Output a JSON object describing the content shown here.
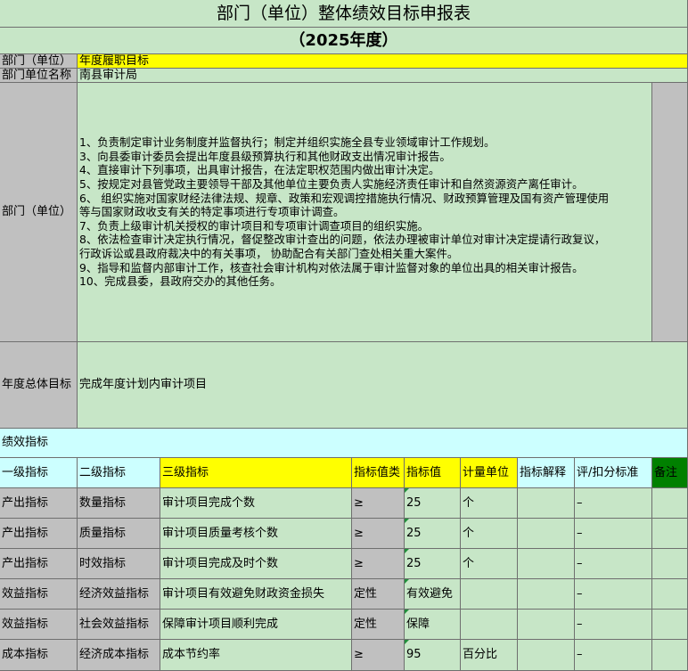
{
  "title": "部门（单位）整体绩效目标申报表",
  "year": "（2025年度）",
  "dept_label": "部门（单位）",
  "dept_value": "年度履职目标",
  "unit_name_label": "部门单位名称",
  "unit_name_value": "南县审计局",
  "duties_label": "部门（单位）",
  "duties": [
    "1、负责制定审计业务制度并监督执行；制定并组织实施全县专业领域审计工作规划。",
    "3、向县委审计委员会提出年度县级预算执行和其他财政支出情况审计报告。",
    "4、直接审计下列事项，出具审计报告，在法定职权范围内做出审计决定。",
    "5、按规定对县管党政主要领导干部及其他单位主要负责人实施经济责任审计和自然资源资产离任审计。",
    "6、  组织实施对国家财经法律法规、规章、政策和宏观调控措施执行情况、财政预算管理及国有资产管理使用",
    "等与国家财政收支有关的特定事项进行专项审计调查。",
    "7、负责上级审计机关授权的审计项目和专项审计调查项目的组织实施。",
    "8、依法检查审计决定执行情况，督促整改审计查出的问题，依法办理被审计单位对审计决定提请行政复议，",
    "行政诉讼或县政府裁决中的有关事项，  协助配合有关部门查处相关重大案件。",
    "9、指导和监督内部审计工作，核查社会审计机构对依法属于审计监督对象的单位出具的相关审计报告。",
    "10、完成县委，县政府交办的其他任务。"
  ],
  "annual_goal_label": "年度总体目标",
  "annual_goal_value": "完成年度计划内审计项目",
  "perf_section_label": "绩效指标",
  "headers": {
    "level1": "一级指标",
    "level2": "二级指标",
    "level3": "三级指标",
    "type": "指标值类",
    "value": "指标值",
    "unit": "计量单位",
    "explain": "指标解释",
    "score": "评/扣分标准",
    "note": "备注"
  },
  "rows": [
    {
      "level1": "产出指标",
      "level2": "数量指标",
      "level3": "审计项目完成个数",
      "type": "≥",
      "value": "25",
      "unit": "个",
      "explain": "",
      "score": "–",
      "note": ""
    },
    {
      "level1": "产出指标",
      "level2": "质量指标",
      "level3": "审计项目质量考核个数",
      "type": "≥",
      "value": "25",
      "unit": "个",
      "explain": "",
      "score": "–",
      "note": ""
    },
    {
      "level1": "产出指标",
      "level2": "时效指标",
      "level3": "审计项目完成及时个数",
      "type": "≥",
      "value": "25",
      "unit": "个",
      "explain": "",
      "score": "–",
      "note": ""
    },
    {
      "level1": "效益指标",
      "level2": "经济效益指标",
      "level3": "审计项目有效避免财政资金损失",
      "type": "定性",
      "value": "有效避免",
      "unit": "",
      "explain": "",
      "score": "–",
      "note": ""
    },
    {
      "level1": "效益指标",
      "level2": "社会效益指标",
      "level3": "保障审计项目顺利完成",
      "type": "定性",
      "value": "保障",
      "unit": "",
      "explain": "",
      "score": "–",
      "note": ""
    },
    {
      "level1": "成本指标",
      "level2": "经济成本指标",
      "level3": "成本节约率",
      "type": "≥",
      "value": "95",
      "unit": "百分比",
      "explain": "",
      "score": "–",
      "note": ""
    }
  ],
  "colors": {
    "sheet_green": "#c7e6c7",
    "label_gray": "#c0c0c0",
    "highlight_yellow": "#ffff00",
    "section_cyan": "#ccffff",
    "note_green": "#008000"
  }
}
